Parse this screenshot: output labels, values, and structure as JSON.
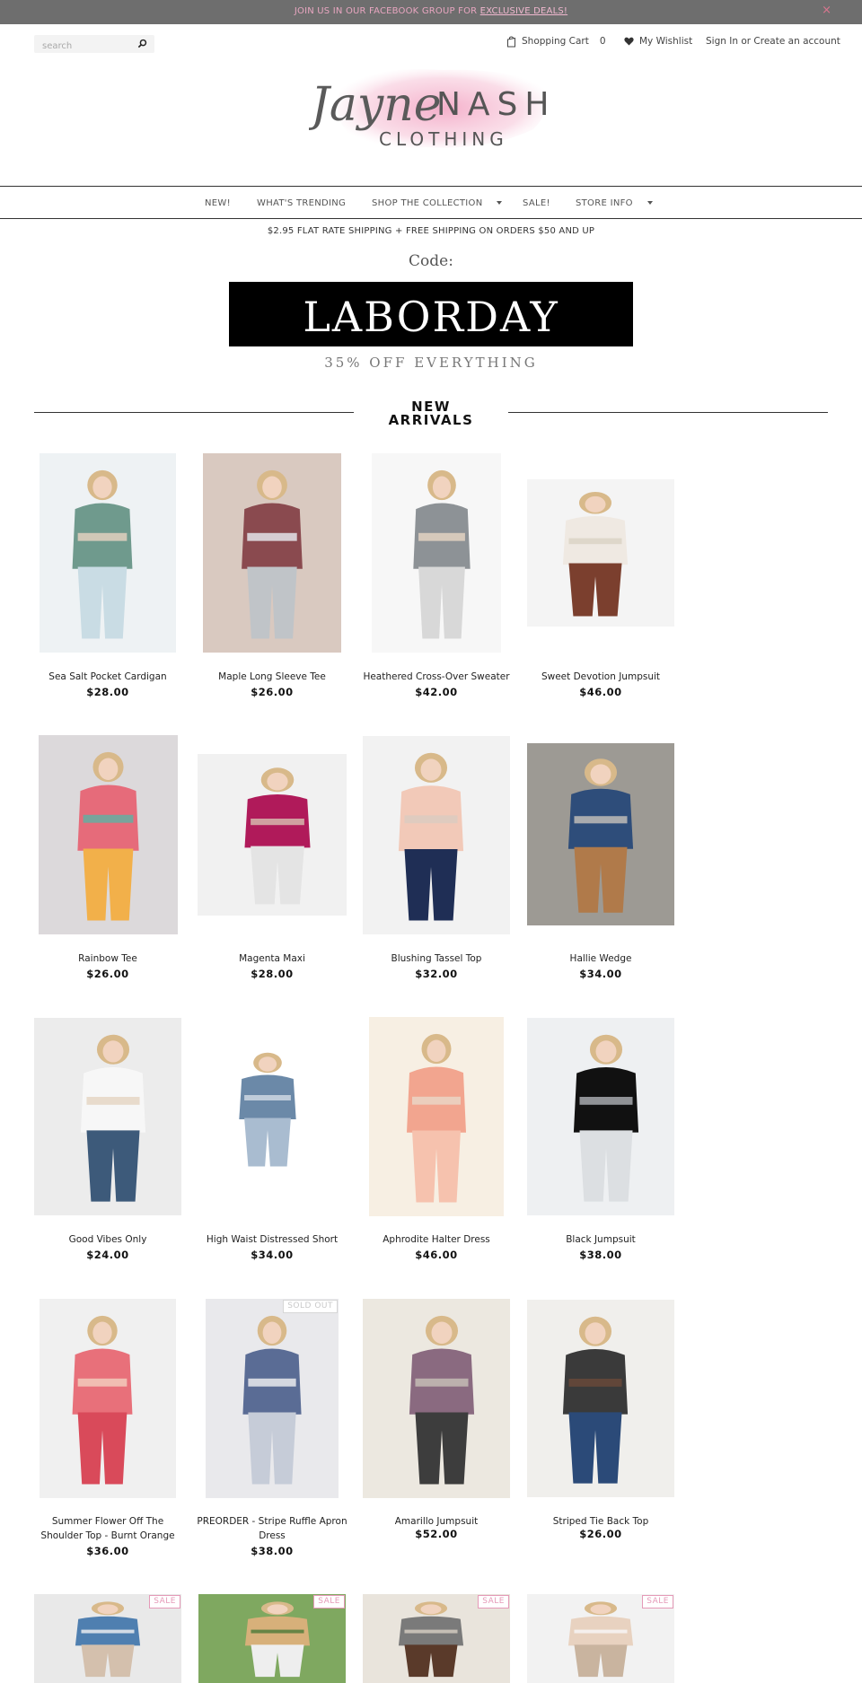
{
  "announcement": {
    "text": "JOIN US IN OUR FACEBOOK GROUP FOR ",
    "link": "EXCLUSIVE DEALS!",
    "close": "×"
  },
  "header": {
    "search_placeholder": "search",
    "cart_label": "Shopping Cart",
    "cart_count": "0",
    "wishlist_label": "My Wishlist",
    "sign_in": "Sign In",
    "or_text": " or ",
    "create_account": "Create an account"
  },
  "logo": {
    "script": "Jayne",
    "name": "NASH",
    "sub": "CLOTHING"
  },
  "nav": [
    {
      "label": "NEW!"
    },
    {
      "label": "WHAT'S TRENDING"
    },
    {
      "label": "SHOP THE COLLECTION"
    },
    {
      "label": "SALE!"
    },
    {
      "label": "STORE INFO"
    }
  ],
  "shipping_notice": "$2.95 FLAT RATE SHIPPING + FREE SHIPPING ON ORDERS $50 AND UP",
  "promo": {
    "label": "Code:",
    "code": "LABORDAY",
    "sub": "35% OFF EVERYTHING"
  },
  "section": {
    "title_line1": "NEW",
    "title_line2": "ARRIVALS"
  },
  "products": [
    {
      "name": "Sea Salt Pocket Cardigan",
      "price": "$28.00",
      "badge": ""
    },
    {
      "name": "Maple Long Sleeve Tee",
      "price": "$26.00",
      "badge": ""
    },
    {
      "name": "Heathered Cross-Over Sweater",
      "price": "$42.00",
      "badge": ""
    },
    {
      "name": "Sweet Devotion Jumpsuit",
      "price": "$46.00",
      "badge": ""
    },
    {
      "name": "Rainbow Tee",
      "price": "$26.00",
      "badge": ""
    },
    {
      "name": "Magenta Maxi",
      "price": "$28.00",
      "badge": ""
    },
    {
      "name": "Blushing Tassel Top",
      "price": "$32.00",
      "badge": ""
    },
    {
      "name": "Hallie Wedge",
      "price": "$34.00",
      "badge": ""
    },
    {
      "name": "Good Vibes Only",
      "price": "$24.00",
      "badge": ""
    },
    {
      "name": "High Waist Distressed Short",
      "price": "$34.00",
      "badge": ""
    },
    {
      "name": "Aphrodite Halter Dress",
      "price": "$46.00",
      "badge": ""
    },
    {
      "name": "Black Jumpsuit",
      "price": "$38.00",
      "badge": ""
    },
    {
      "name": "Summer Flower Off The Shoulder Top - Burnt Orange",
      "price": "$36.00",
      "badge": ""
    },
    {
      "name": "PREORDER - Stripe Ruffle Apron Dress",
      "price": "$38.00",
      "badge": "SOLD OUT"
    },
    {
      "name": "Amarillo Jumpsuit",
      "price": "$52.00",
      "badge": ""
    },
    {
      "name": "Striped Tie Back Top",
      "price": "$26.00",
      "badge": ""
    },
    {
      "name": "",
      "price": "",
      "badge": "SALE"
    },
    {
      "name": "",
      "price": "",
      "badge": "SALE"
    },
    {
      "name": "",
      "price": "",
      "badge": "SALE"
    },
    {
      "name": "",
      "price": "",
      "badge": "SALE"
    }
  ],
  "colors": {
    "topbar": "#6e6e6e",
    "accent_pink": "#e59ab8",
    "promo_bg": "#000000"
  }
}
